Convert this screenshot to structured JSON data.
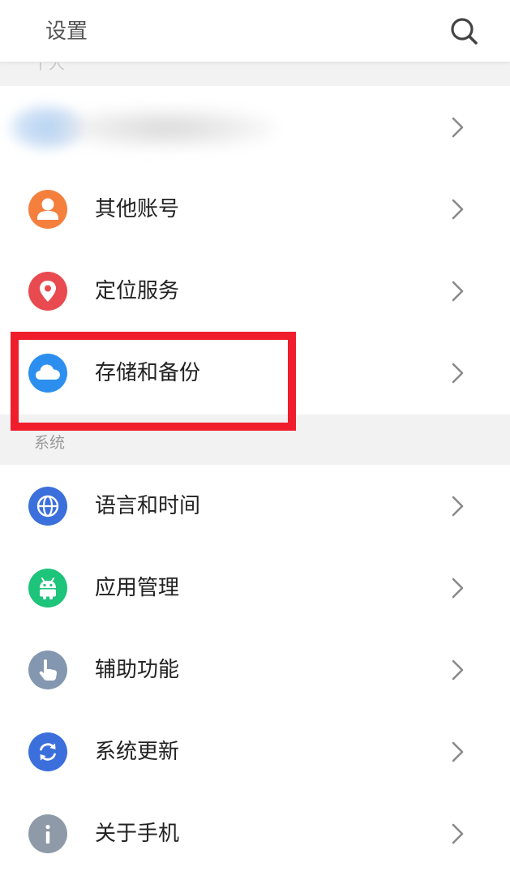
{
  "header": {
    "title": "设置",
    "search_icon": "search-icon"
  },
  "personal_section": {
    "label": "个人",
    "items": [
      {
        "label": "",
        "icon": "avatar-blurred"
      },
      {
        "label": "其他账号",
        "icon": "person-icon",
        "color": "#f57f3d"
      },
      {
        "label": "定位服务",
        "icon": "location-pin-icon",
        "color": "#e84a4f"
      },
      {
        "label": "存储和备份",
        "icon": "cloud-icon",
        "color": "#2c8ff0"
      }
    ]
  },
  "system_section": {
    "label": "系统",
    "items": [
      {
        "label": "语言和时间",
        "icon": "globe-icon",
        "color": "#3b6fdc"
      },
      {
        "label": "应用管理",
        "icon": "android-icon",
        "color": "#1dc47a"
      },
      {
        "label": "辅助功能",
        "icon": "hand-pointer-icon",
        "color": "#8497b0"
      },
      {
        "label": "系统更新",
        "icon": "refresh-icon",
        "color": "#3b6fdc"
      },
      {
        "label": "关于手机",
        "icon": "info-icon",
        "color": "#8e9aa8"
      }
    ]
  },
  "highlight_color": "#f01e2c"
}
